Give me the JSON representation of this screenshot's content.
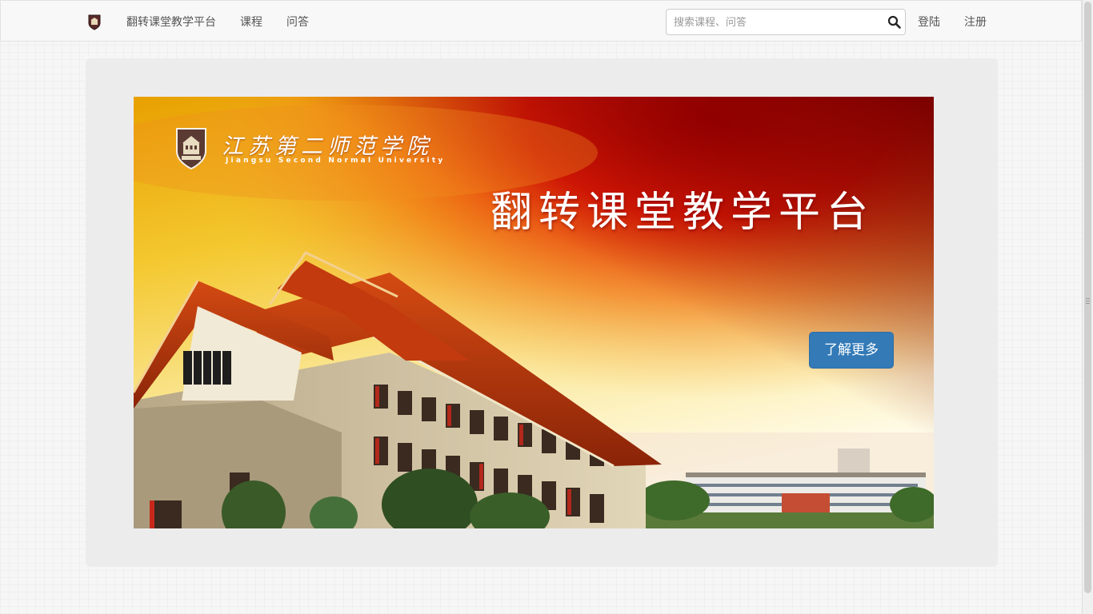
{
  "nav": {
    "brand_label": "翻转课堂教学平台",
    "links": [
      {
        "label": "课程"
      },
      {
        "label": "问答"
      }
    ],
    "search_placeholder": "搜索课程、问答",
    "login_label": "登陆",
    "register_label": "注册"
  },
  "banner": {
    "school_name_cn": "江苏第二师范学院",
    "school_name_en": "Jiangsu Second Normal University",
    "title": "翻转课堂教学平台",
    "button_label": "了解更多"
  },
  "colors": {
    "primary_button": "#337ab7",
    "navbar_bg": "#f8f8f8",
    "jumbotron_bg": "#ececec"
  },
  "icons": {
    "brand": "school-crest-icon",
    "search": "magnifier-icon"
  }
}
